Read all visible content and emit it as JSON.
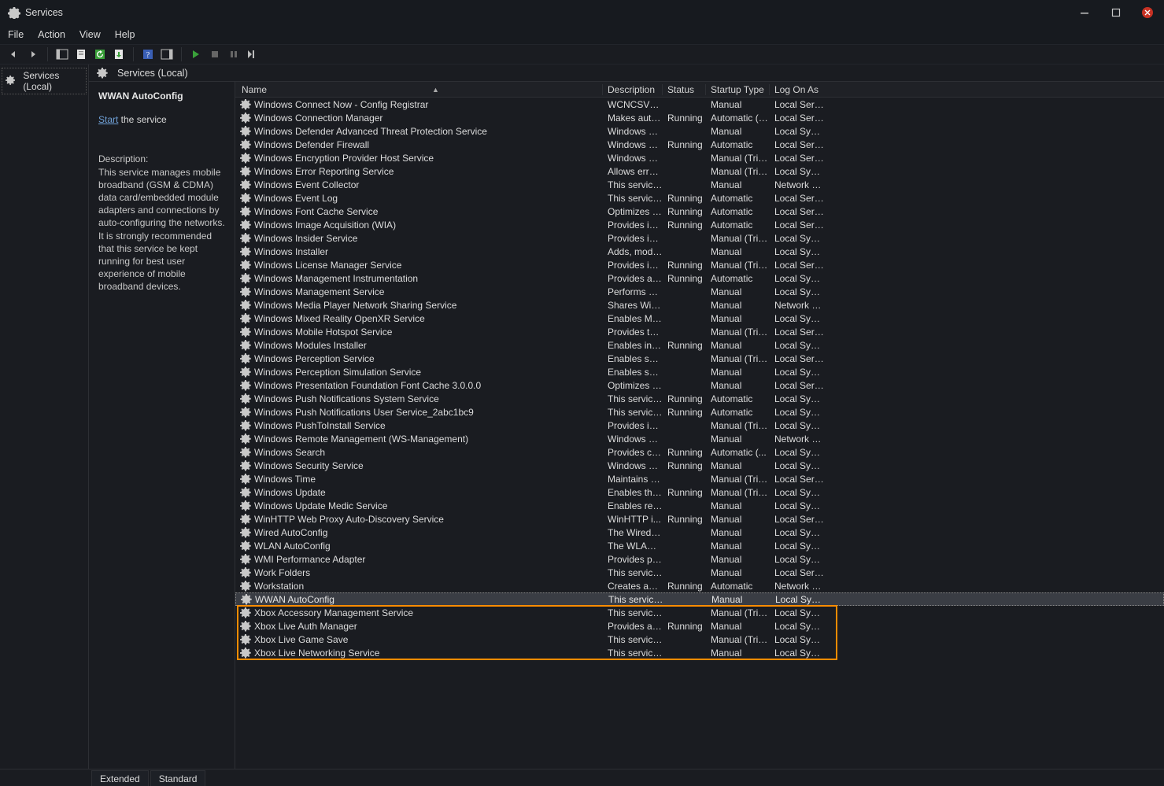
{
  "window": {
    "title": "Services"
  },
  "menus": {
    "file": "File",
    "action": "Action",
    "view": "View",
    "help": "Help"
  },
  "tree": {
    "root": "Services (Local)"
  },
  "center_header": "Services (Local)",
  "detail": {
    "selected_name": "WWAN AutoConfig",
    "start_link": "Start",
    "start_suffix": " the service",
    "desc_label": "Description:",
    "desc_text": "This service manages mobile broadband (GSM & CDMA) data card/embedded module adapters and connections by auto-configuring the networks. It is strongly recommended that this service be kept running for best user experience of mobile broadband devices."
  },
  "columns": {
    "name": "Name",
    "description": "Description",
    "status": "Status",
    "startup": "Startup Type",
    "logon": "Log On As"
  },
  "tabs": {
    "extended": "Extended",
    "standard": "Standard"
  },
  "services": [
    {
      "name": "Windows Connect Now - Config Registrar",
      "desc": "WCNCSVC ...",
      "status": "",
      "startup": "Manual",
      "logon": "Local Service"
    },
    {
      "name": "Windows Connection Manager",
      "desc": "Makes auto...",
      "status": "Running",
      "startup": "Automatic (T...",
      "logon": "Local Service"
    },
    {
      "name": "Windows Defender Advanced Threat Protection Service",
      "desc": "Windows D...",
      "status": "",
      "startup": "Manual",
      "logon": "Local Syste..."
    },
    {
      "name": "Windows Defender Firewall",
      "desc": "Windows D...",
      "status": "Running",
      "startup": "Automatic",
      "logon": "Local Service"
    },
    {
      "name": "Windows Encryption Provider Host Service",
      "desc": "Windows E...",
      "status": "",
      "startup": "Manual (Trig...",
      "logon": "Local Service"
    },
    {
      "name": "Windows Error Reporting Service",
      "desc": "Allows error...",
      "status": "",
      "startup": "Manual (Trig...",
      "logon": "Local Syste..."
    },
    {
      "name": "Windows Event Collector",
      "desc": "This service ...",
      "status": "",
      "startup": "Manual",
      "logon": "Network S..."
    },
    {
      "name": "Windows Event Log",
      "desc": "This service ...",
      "status": "Running",
      "startup": "Automatic",
      "logon": "Local Service"
    },
    {
      "name": "Windows Font Cache Service",
      "desc": "Optimizes p...",
      "status": "Running",
      "startup": "Automatic",
      "logon": "Local Service"
    },
    {
      "name": "Windows Image Acquisition (WIA)",
      "desc": "Provides im...",
      "status": "Running",
      "startup": "Automatic",
      "logon": "Local Service"
    },
    {
      "name": "Windows Insider Service",
      "desc": "Provides inf...",
      "status": "",
      "startup": "Manual (Trig...",
      "logon": "Local Syste..."
    },
    {
      "name": "Windows Installer",
      "desc": "Adds, modi...",
      "status": "",
      "startup": "Manual",
      "logon": "Local Syste..."
    },
    {
      "name": "Windows License Manager Service",
      "desc": "Provides inf...",
      "status": "Running",
      "startup": "Manual (Trig...",
      "logon": "Local Service"
    },
    {
      "name": "Windows Management Instrumentation",
      "desc": "Provides a c...",
      "status": "Running",
      "startup": "Automatic",
      "logon": "Local Syste..."
    },
    {
      "name": "Windows Management Service",
      "desc": "Performs m...",
      "status": "",
      "startup": "Manual",
      "logon": "Local Syste..."
    },
    {
      "name": "Windows Media Player Network Sharing Service",
      "desc": "Shares Win...",
      "status": "",
      "startup": "Manual",
      "logon": "Network S..."
    },
    {
      "name": "Windows Mixed Reality OpenXR Service",
      "desc": "Enables Mix...",
      "status": "",
      "startup": "Manual",
      "logon": "Local Syste..."
    },
    {
      "name": "Windows Mobile Hotspot Service",
      "desc": "Provides th...",
      "status": "",
      "startup": "Manual (Trig...",
      "logon": "Local Service"
    },
    {
      "name": "Windows Modules Installer",
      "desc": "Enables inst...",
      "status": "Running",
      "startup": "Manual",
      "logon": "Local Syste..."
    },
    {
      "name": "Windows Perception Service",
      "desc": "Enables spa...",
      "status": "",
      "startup": "Manual (Trig...",
      "logon": "Local Service"
    },
    {
      "name": "Windows Perception Simulation Service",
      "desc": "Enables spa...",
      "status": "",
      "startup": "Manual",
      "logon": "Local Syste..."
    },
    {
      "name": "Windows Presentation Foundation Font Cache 3.0.0.0",
      "desc": "Optimizes p...",
      "status": "",
      "startup": "Manual",
      "logon": "Local Service"
    },
    {
      "name": "Windows Push Notifications System Service",
      "desc": "This service ...",
      "status": "Running",
      "startup": "Automatic",
      "logon": "Local Syste..."
    },
    {
      "name": "Windows Push Notifications User Service_2abc1bc9",
      "desc": "This service ...",
      "status": "Running",
      "startup": "Automatic",
      "logon": "Local Syste..."
    },
    {
      "name": "Windows PushToInstall Service",
      "desc": "Provides inf...",
      "status": "",
      "startup": "Manual (Trig...",
      "logon": "Local Syste..."
    },
    {
      "name": "Windows Remote Management (WS-Management)",
      "desc": "Windows R...",
      "status": "",
      "startup": "Manual",
      "logon": "Network S..."
    },
    {
      "name": "Windows Search",
      "desc": "Provides co...",
      "status": "Running",
      "startup": "Automatic (...",
      "logon": "Local Syste..."
    },
    {
      "name": "Windows Security Service",
      "desc": "Windows Se...",
      "status": "Running",
      "startup": "Manual",
      "logon": "Local Syste..."
    },
    {
      "name": "Windows Time",
      "desc": "Maintains d...",
      "status": "",
      "startup": "Manual (Trig...",
      "logon": "Local Service"
    },
    {
      "name": "Windows Update",
      "desc": "Enables the ...",
      "status": "Running",
      "startup": "Manual (Trig...",
      "logon": "Local Syste..."
    },
    {
      "name": "Windows Update Medic Service",
      "desc": "Enables rem...",
      "status": "",
      "startup": "Manual",
      "logon": "Local Syste..."
    },
    {
      "name": "WinHTTP Web Proxy Auto-Discovery Service",
      "desc": "WinHTTP i...",
      "status": "Running",
      "startup": "Manual",
      "logon": "Local Service"
    },
    {
      "name": "Wired AutoConfig",
      "desc": "The Wired A...",
      "status": "",
      "startup": "Manual",
      "logon": "Local Syste..."
    },
    {
      "name": "WLAN AutoConfig",
      "desc": "The WLANS...",
      "status": "",
      "startup": "Manual",
      "logon": "Local Syste..."
    },
    {
      "name": "WMI Performance Adapter",
      "desc": "Provides pe...",
      "status": "",
      "startup": "Manual",
      "logon": "Local Syste..."
    },
    {
      "name": "Work Folders",
      "desc": "This service ...",
      "status": "",
      "startup": "Manual",
      "logon": "Local Service"
    },
    {
      "name": "Workstation",
      "desc": "Creates and...",
      "status": "Running",
      "startup": "Automatic",
      "logon": "Network S..."
    },
    {
      "name": "WWAN AutoConfig",
      "desc": "This service ...",
      "status": "",
      "startup": "Manual",
      "logon": "Local Syste..."
    },
    {
      "name": "Xbox Accessory Management Service",
      "desc": "This service ...",
      "status": "",
      "startup": "Manual (Trig...",
      "logon": "Local Syste..."
    },
    {
      "name": "Xbox Live Auth Manager",
      "desc": "Provides au...",
      "status": "Running",
      "startup": "Manual",
      "logon": "Local Syste..."
    },
    {
      "name": "Xbox Live Game Save",
      "desc": "This service ...",
      "status": "",
      "startup": "Manual (Trig...",
      "logon": "Local Syste..."
    },
    {
      "name": "Xbox Live Networking Service",
      "desc": "This service ...",
      "status": "",
      "startup": "Manual",
      "logon": "Local Syste..."
    }
  ],
  "selected_index": 37,
  "highlight_start": 38,
  "highlight_end": 41
}
